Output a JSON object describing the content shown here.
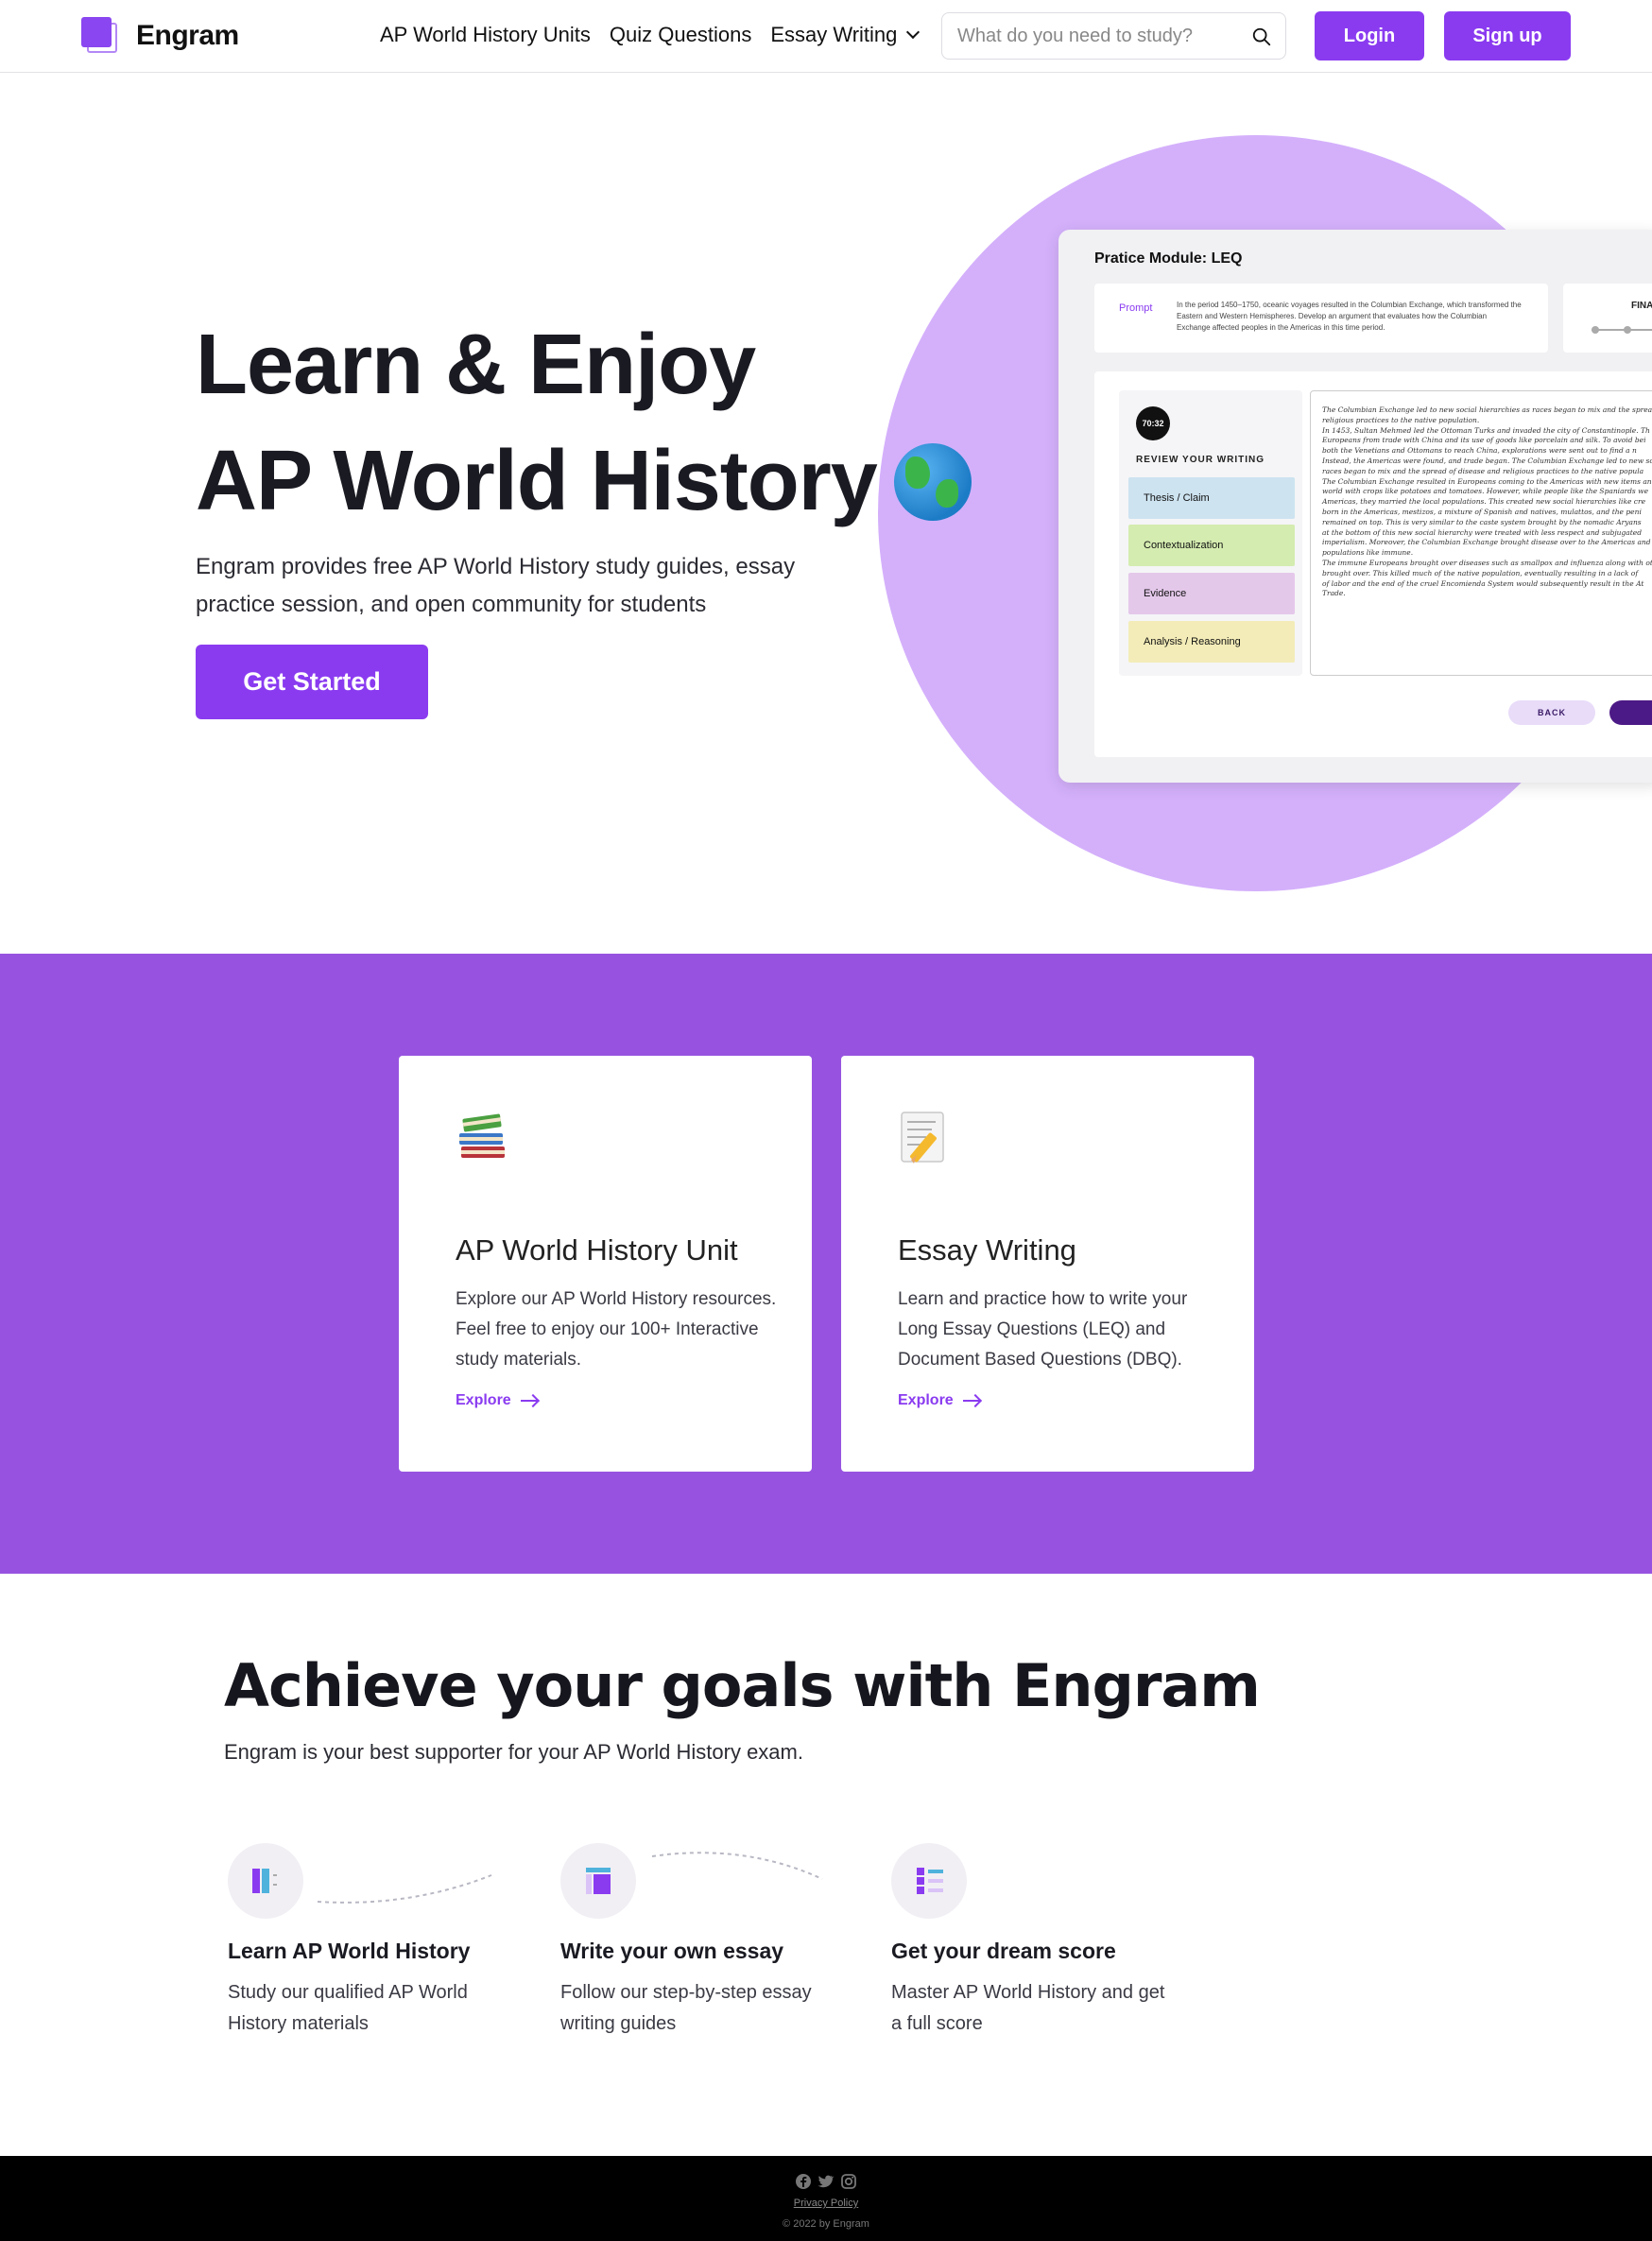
{
  "nav": {
    "logo_text": "Engram",
    "links": [
      "AP World History Units",
      "Quiz Questions",
      "Essay Writing"
    ],
    "search_placeholder": "What do you need to study?",
    "login_label": "Login",
    "signup_label": "Sign up"
  },
  "hero": {
    "title_line1": "Learn & Enjoy",
    "title_line2": "AP World History",
    "subtitle": "Engram provides free AP World History study guides, essay practice session, and open community for students",
    "cta_label": "Get Started",
    "accent_color": "#8a3bf0",
    "circle_color": "#d4b0fb"
  },
  "mockup": {
    "title": "Pratice Module: LEQ",
    "prompt_label": "Prompt",
    "prompt_text": "In the period 1450–1750, oceanic voyages resulted in the Columbian Exchange, which transformed the Eastern and Western Hemispheres. Develop an argument that evaluates how the Columbian Exchange affected peoples in the Americas in this time period.",
    "final_label": "FINA",
    "timer": "70:32",
    "review_label": "REVIEW YOUR WRITING",
    "review_items": [
      {
        "label": "Thesis / Claim",
        "color": "#cde3f0"
      },
      {
        "label": "Contextualization",
        "color": "#d4ecb0"
      },
      {
        "label": "Evidence",
        "color": "#e4c8ea"
      },
      {
        "label": "Analysis / Reasoning",
        "color": "#f3ecb8"
      }
    ],
    "essay_lines": [
      "The Columbian Exchange led to new social hierarchies as races began to mix and the spread",
      "religious practices to the native population.",
      "In 1453, Sultan Mehmed led the Ottoman Turks and invaded the city of Constantinople. Th",
      "Europeans from trade with China and its use of goods like porcelain and silk. To avoid bei",
      "both the Venetians and Ottomans to reach China, explorations were sent out to find a n",
      "Instead, the Americas were found, and trade began. The Columbian Exchange led to new soc",
      "races began to mix and the spread of disease and religious practices to the native popula",
      "The Columbian Exchange resulted in Europeans coming to the Americas with new items an",
      "world with crops like potatoes and tomatoes. However, while people like the Spaniards we",
      "Americas, they married the local populations. This created new social hierarchies like cre",
      "born in the Americas, mestizos, a mixture of Spanish and natives, mulattos, and the peni",
      "remained on top. This is very similar to the caste system brought by the nomadic Aryans",
      "at the bottom of this new social hierarchy were treated with less respect and subjugated",
      "imperialism. Moreover, the Columbian Exchange brought disease over to the Americas and",
      "populations like immune.",
      "The immune Europeans brought over diseases such as smallpox and influenza along with ot",
      "brought over. This killed much of the native population, eventually resulting in a lack of",
      "of labor and the end of the cruel Encomienda System would subsequently result in the At",
      "Trade."
    ],
    "back_label": "BACK"
  },
  "features": {
    "background": "#9753e0",
    "cards": [
      {
        "icon": "books-icon",
        "title": "AP World History Unit",
        "description": "Explore our AP World History resources. Feel free to enjoy our 100+ Interactive study materials.",
        "link_label": "Explore"
      },
      {
        "icon": "memo-pencil-icon",
        "title": "Essay Writing",
        "description": "Learn and practice how to write your Long Essay Questions (LEQ) and Document Based Questions (DBQ).",
        "link_label": "Explore"
      }
    ]
  },
  "goals": {
    "title": "Achieve your goals with Engram",
    "subtitle": "Engram is your best supporter for your AP World History exam.",
    "steps": [
      {
        "icon": "book-columns-icon",
        "title": "Learn AP World History",
        "description": "Study our qualified AP World History materials"
      },
      {
        "icon": "layout-icon",
        "title": "Write your own essay",
        "description": "Follow our step-by-step essay writing guides"
      },
      {
        "icon": "list-icon",
        "title": "Get your dream score",
        "description": "Master AP World History and get a full score"
      }
    ]
  },
  "footer": {
    "social_icons": [
      "facebook-icon",
      "twitter-icon",
      "instagram-icon"
    ],
    "privacy_label": "Privacy Policy",
    "copyright": "© 2022 by Engram"
  }
}
